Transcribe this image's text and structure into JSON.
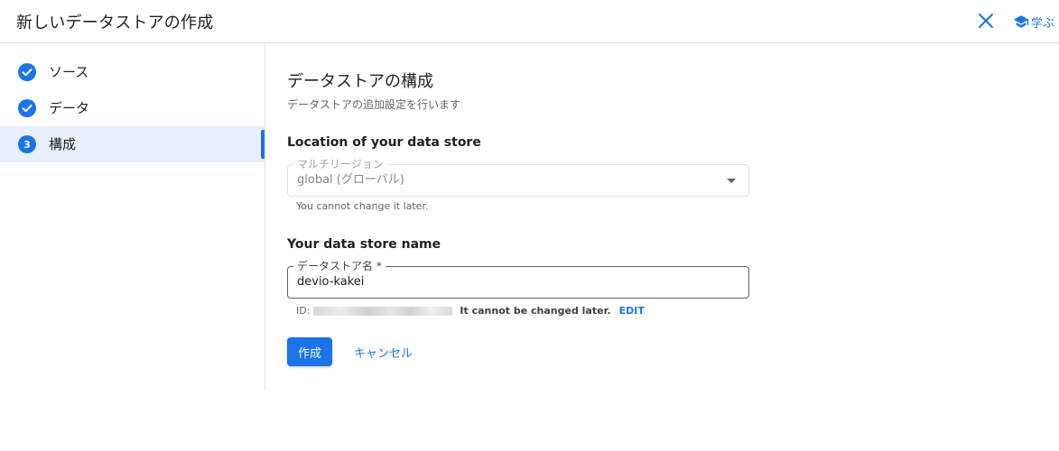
{
  "header": {
    "title": "新しいデータストアの作成",
    "learn_label": "学ぶ"
  },
  "sidebar": {
    "steps": [
      {
        "label": "ソース",
        "status": "done"
      },
      {
        "label": "データ",
        "status": "done"
      },
      {
        "label": "構成",
        "status": "active",
        "number": "3"
      }
    ]
  },
  "main": {
    "title": "データストアの構成",
    "description": "データストアの追加設定を行います",
    "location": {
      "heading": "Location of your data store",
      "field_label": "マルチリージョン",
      "value": "global (グローバル)",
      "hint": "You cannot change it later."
    },
    "name": {
      "heading": "Your data store name",
      "field_label": "データストア名 *",
      "value": "devio-kakei",
      "id_prefix": "ID:",
      "id_note": "It cannot be changed later.",
      "edit_label": "EDIT"
    },
    "actions": {
      "create_label": "作成",
      "cancel_label": "キャンセル"
    }
  },
  "colors": {
    "accent": "#1a73e8",
    "active_bg": "#e8f0fe",
    "border": "#dadce0"
  }
}
